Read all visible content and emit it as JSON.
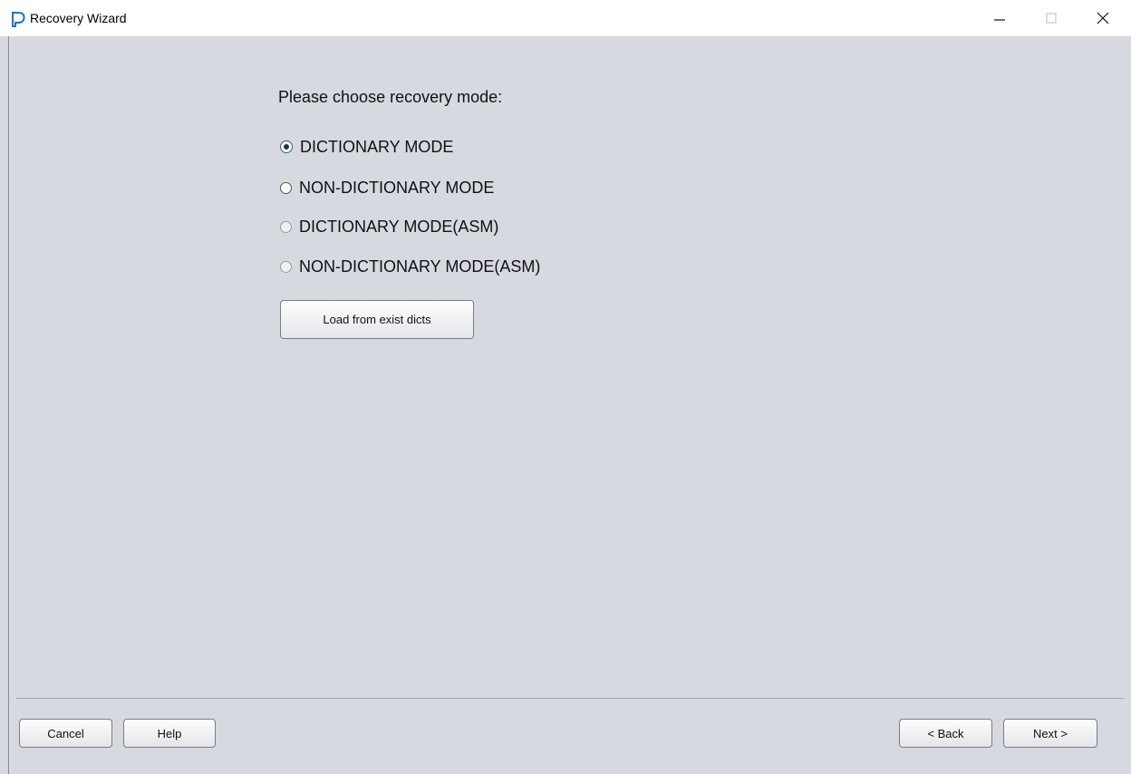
{
  "window": {
    "title": "Recovery Wizard",
    "icon": "app-p-icon",
    "controls": {
      "minimize": "minimize-icon",
      "maximize": "maximize-icon",
      "close": "close-icon"
    }
  },
  "main": {
    "prompt": "Please choose recovery mode:",
    "modes": [
      {
        "label": "DICTIONARY MODE",
        "selected": true,
        "enabled": true
      },
      {
        "label": "NON-DICTIONARY MODE",
        "selected": false,
        "enabled": true
      },
      {
        "label": "DICTIONARY MODE(ASM)",
        "selected": false,
        "enabled": false
      },
      {
        "label": "NON-DICTIONARY MODE(ASM)",
        "selected": false,
        "enabled": false
      }
    ],
    "load_button": "Load from exist dicts"
  },
  "footer": {
    "cancel": "Cancel",
    "help": "Help",
    "back": "< Back",
    "next": "Next >"
  },
  "colors": {
    "background": "#d6d9e0",
    "titlebar": "#ffffff",
    "accent": "#2c5a96",
    "app_icon": "#1a73c9"
  }
}
